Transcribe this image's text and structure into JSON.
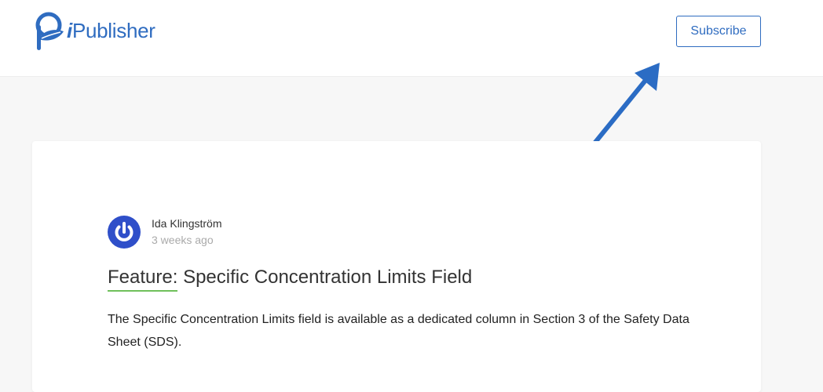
{
  "header": {
    "logo": {
      "prefix": "i",
      "name": "Publisher"
    },
    "subscribe_label": "Subscribe"
  },
  "post": {
    "author": "Ida Klingström",
    "time": "3 weeks ago",
    "category": "Feature:",
    "title": "Specific Concentration Limits Field",
    "body": "The Specific Concentration Limits field is available as a dedicated column in Section 3 of the Safety Data Sheet (SDS)."
  },
  "colors": {
    "brand": "#2f6cc0",
    "category_underline": "#6fc05b",
    "page_background": "#f7f7f7"
  },
  "icons": {
    "logo": "leaf-p-logo-icon",
    "avatar": "power-icon",
    "annotation": "arrow-annotation-icon"
  }
}
